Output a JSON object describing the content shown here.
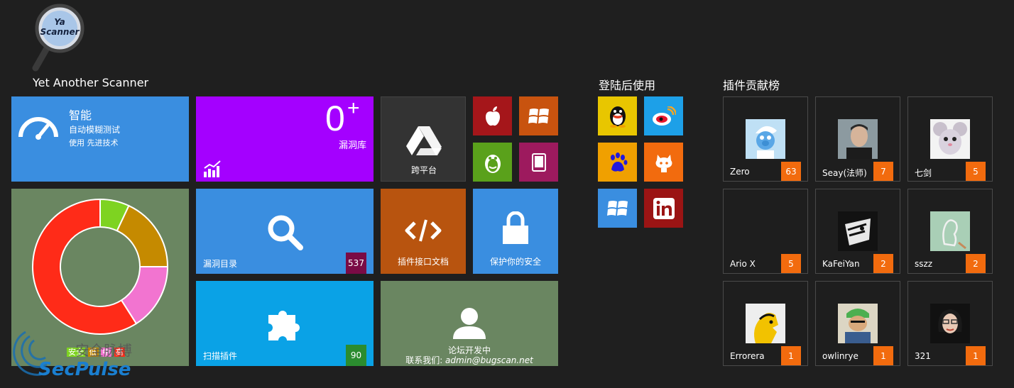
{
  "app": {
    "logo_text": "Ya Scanner",
    "title": "Yet Another Scanner"
  },
  "tiles": {
    "smart": {
      "title": "智能",
      "line1": "自动模糊测试",
      "line2": "使用 先进技术",
      "icon": "speedometer-icon",
      "color": "#3a8ee0"
    },
    "vuln_db": {
      "count": "0",
      "sup": "+",
      "label": "漏洞库",
      "icon": "chart-up-icon",
      "color": "#a400ff"
    },
    "cross_platform": {
      "label": "跨平台",
      "icon": "google-drive-icon",
      "color": "#333333"
    },
    "platforms": [
      {
        "icon": "apple-icon",
        "color": "#a5161a"
      },
      {
        "icon": "windows-icon",
        "color": "#c8530f"
      },
      {
        "icon": "android-icon",
        "color": "#5aa11b"
      },
      {
        "icon": "tablet-icon",
        "color": "#9d1a5e"
      }
    ],
    "vuln_catalog": {
      "label": "漏洞目录",
      "count": "537",
      "icon": "search-icon",
      "color": "#3a8ee0",
      "badge_color": "#7a0b45"
    },
    "plugin_api": {
      "label": "插件接口文档",
      "icon": "code-icon",
      "color": "#b8540f"
    },
    "protect": {
      "label": "保护你的安全",
      "icon": "lock-icon",
      "color": "#3a8ee0"
    },
    "scan_plugins": {
      "label": "扫描插件",
      "count": "90",
      "icon": "puzzle-icon",
      "color": "#0aa2e6",
      "badge_color": "#2b8c2f"
    },
    "forum": {
      "line1": "论坛开发中",
      "line2_prefix": "联系我们: ",
      "email": "admin@bugscan.net",
      "icon": "user-icon",
      "color": "#6a8661"
    }
  },
  "donut": {
    "legend": [
      "安全",
      "低",
      "中",
      "高"
    ],
    "segments": [
      {
        "name": "安全",
        "value": 7,
        "color": "#7ed321"
      },
      {
        "name": "低",
        "value": 18,
        "color": "#c58a00"
      },
      {
        "name": "中",
        "value": 16,
        "color": "#f274d0"
      },
      {
        "name": "高",
        "value": 59,
        "color": "#ff2b18"
      }
    ],
    "tile_color": "#6a8661"
  },
  "watermark": {
    "brand": "SecPulse",
    "cn": "安全脉搏"
  },
  "login": {
    "title": "登陆后使用",
    "providers": [
      {
        "name": "qq",
        "icon": "qq-penguin-icon",
        "color": "#e8c600"
      },
      {
        "name": "weibo",
        "icon": "weibo-icon",
        "color": "#1da0e8"
      },
      {
        "name": "baidu",
        "icon": "baidu-paw-icon",
        "color": "#f0a000"
      },
      {
        "name": "github",
        "icon": "github-icon",
        "color": "#f26b0e"
      },
      {
        "name": "windows",
        "icon": "windows-icon",
        "color": "#3a8ee0"
      },
      {
        "name": "linkedin",
        "icon": "linkedin-icon",
        "color": "#9b1414"
      }
    ]
  },
  "contributors": {
    "title": "插件贡献榜",
    "items": [
      {
        "name": "Zero",
        "count": "63",
        "avatar": "smurf-avatar"
      },
      {
        "name": "Seay(法师)",
        "count": "7",
        "avatar": "man-avatar"
      },
      {
        "name": "七剑",
        "count": "5",
        "avatar": "mouse-avatar"
      },
      {
        "name": "Ario X",
        "count": "5",
        "avatar": ""
      },
      {
        "name": "KaFeiYan",
        "count": "2",
        "avatar": "sketch-avatar"
      },
      {
        "name": "sszz",
        "count": "2",
        "avatar": "drawing-avatar"
      },
      {
        "name": "Errorera",
        "count": "1",
        "avatar": "yellow-avatar"
      },
      {
        "name": "owlinrye",
        "count": "1",
        "avatar": "anime-avatar"
      },
      {
        "name": "321",
        "count": "1",
        "avatar": "woman-avatar"
      }
    ]
  }
}
